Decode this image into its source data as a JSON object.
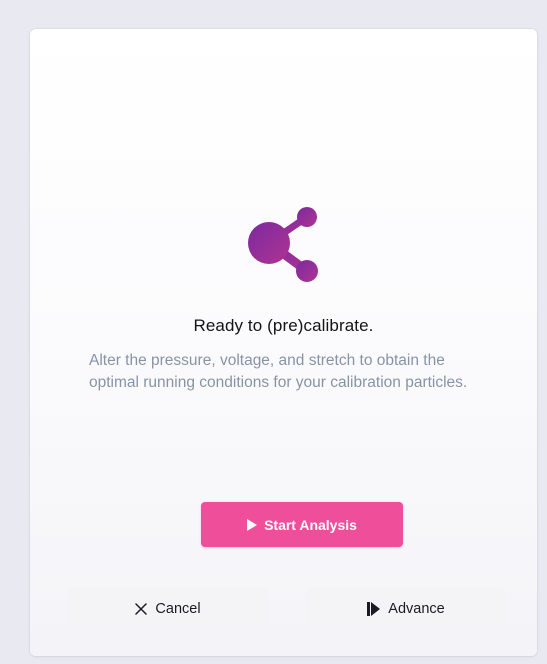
{
  "dialog": {
    "title": "Ready to (pre)calibrate.",
    "description": "Alter the pressure, voltage, and stretch to obtain the optimal running conditions for your calibration particles."
  },
  "buttons": {
    "start_label": "Start Analysis",
    "cancel_label": "Cancel",
    "advance_label": "Advance"
  },
  "icons": {
    "logo": "particle-logo-icon",
    "start": "play-icon",
    "cancel": "close-icon",
    "advance": "skip-forward-icon"
  },
  "colors": {
    "accent": "#ef4e9b",
    "logo_start": "#7a2a9e",
    "logo_end": "#b03393",
    "description": "#8894a6"
  }
}
